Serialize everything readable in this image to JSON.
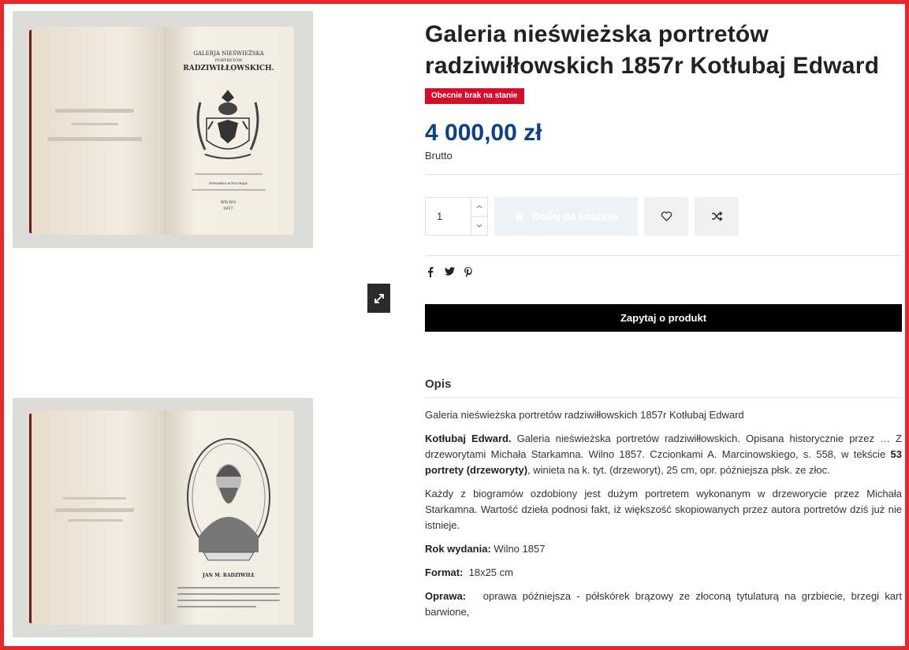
{
  "product": {
    "title": "Galeria nieświeżska portretów radziwiłłowskich 1857r Kotłubaj Edward",
    "stock_badge": "Obecnie brak na stanie",
    "price": "4 000,00 zł",
    "price_note": "Brutto"
  },
  "gallery": {
    "book1": {
      "line1": "GALERJA NIEŚWIEŻSKA",
      "line2": "PORTRETÓW",
      "line3": "RADZIWIŁŁOWSKICH.",
      "author": "EDWARDA KOTŁUBAJA.",
      "place": "WILNO.",
      "year": "1857."
    },
    "book2": {
      "caption": "JAN M. RADZIWIŁŁ"
    }
  },
  "purchase": {
    "quantity": "1",
    "add_to_cart_label": "Dodaj do koszyka"
  },
  "ask_button_label": "Zapytaj o produkt",
  "description": {
    "heading": "Opis",
    "intro": "Galeria nieświeżska portretów radziwiłłowskich 1857r Kotłubaj Edward",
    "author_bold": "Kotłubaj Edward.",
    "p1_part1": " Galeria nieświeżska portretów radziwiłłowskich. Opisana historycznie przez … Z drzeworytami Michała Starkamna. Wilno 1857. Czcionkami A. Marcinowskiego, s. 558, w tekście ",
    "p1_bold": "53 portrety (drzeworyty)",
    "p1_part2": ", winieta na k. tyt. (drzeworyt), 25 cm, opr. późniejsza płsk. ze złoc.",
    "p2": "Każdy z biogramów ozdobiony jest dużym portretem wykonanym w drzeworycie przez Michała Starkamna. Wartość dzieła podnosi fakt, iż większość skopiowanych przez autora portretów dziś już nie istnieje.",
    "year_label": "Rok wydania:",
    "year_value": " Wilno 1857",
    "format_label": "Format:",
    "format_value": "  18x25 cm",
    "binding_label": "Oprawa:",
    "binding_value": "   oprawa późniejsza - półskórek brązowy ze złoconą tytulaturą na grzbiecie, brzegi kart barwione,"
  }
}
